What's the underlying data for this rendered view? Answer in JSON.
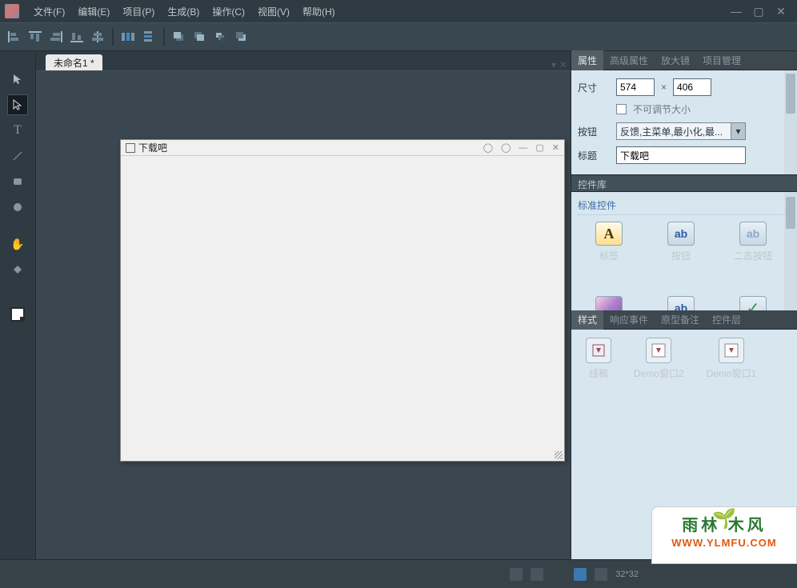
{
  "menu": [
    "文件(F)",
    "编辑(E)",
    "项目(P)",
    "生成(B)",
    "操作(C)",
    "视图(V)",
    "帮助(H)"
  ],
  "document": {
    "tab_title": "未命名1 *"
  },
  "design_window": {
    "title": "下载吧"
  },
  "properties": {
    "tabs": [
      "属性",
      "高级属性",
      "放大镜",
      "项目管理"
    ],
    "size_label": "尺寸",
    "width": "574",
    "height": "406",
    "lock_size_label": "不可调节大小",
    "button_label": "按钮",
    "button_value": "反馈,主菜单,最小化,最...",
    "title_label": "标题",
    "title_value": "下载吧"
  },
  "library": {
    "header": "控件库",
    "group_title": "标准控件",
    "items": [
      "标签",
      "按钮",
      "二态按钮"
    ]
  },
  "styles": {
    "tabs": [
      "样式",
      "响应事件",
      "原型备注",
      "控件层"
    ],
    "items": [
      "线稿",
      "Demo窗口2",
      "Demo窗口1"
    ]
  },
  "status": {
    "coords": "32*32"
  },
  "watermark": {
    "line1": "雨林  木风",
    "line2": "WWW.YLMFU.COM"
  }
}
